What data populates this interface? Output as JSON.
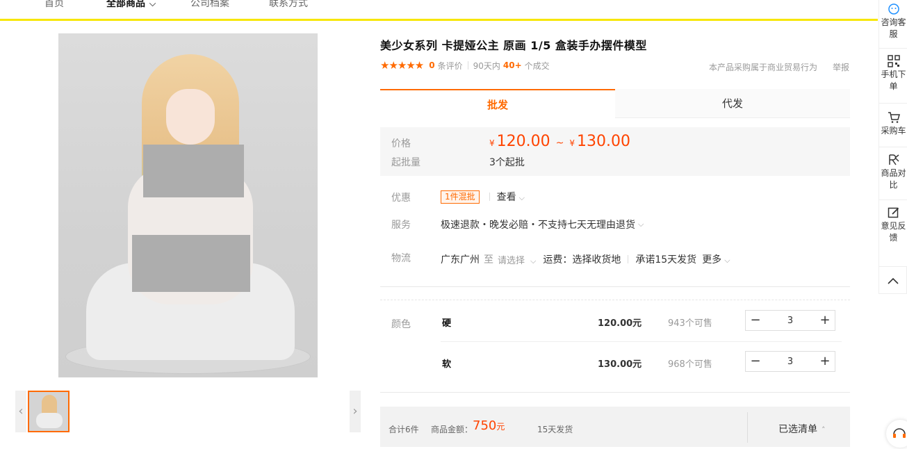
{
  "nav": {
    "items": [
      "首页",
      "全部商品",
      "公司档案",
      "联系方式"
    ]
  },
  "product": {
    "title": "美少女系列 卡提娅公主 原画 1/5 盒装手办摆件模型",
    "rating": {
      "stars": 5,
      "review_count": "0",
      "review_suffix": "条评价",
      "sales_prefix": "90天内",
      "sales_count": "40+",
      "sales_suffix": "个成交"
    },
    "business_note": "本产品采购属于商业贸易行为",
    "report_label": "举报"
  },
  "tabs": [
    {
      "label": "批发",
      "active": true
    },
    {
      "label": "代发",
      "active": false
    }
  ],
  "pricing": {
    "price_label": "价格",
    "currency": "¥",
    "price_min": "120.00",
    "price_max": "130.00",
    "range_sep": "~",
    "moq_label": "起批量",
    "moq_value": "3个起批"
  },
  "promo": {
    "label": "优惠",
    "badge": "1件混批",
    "view_label": "查看"
  },
  "service": {
    "label": "服务",
    "value": "极速退款・晚发必赔・不支持七天无理由退货"
  },
  "logistics": {
    "label": "物流",
    "from": "广东广州",
    "to_word": "至",
    "to_placeholder": "请选择",
    "freight": "运费：选择收货地",
    "promise": "承诺15天发货",
    "more": "更多"
  },
  "sku": {
    "label": "颜色",
    "rows": [
      {
        "name": "硬",
        "price": "120.00元",
        "stock": "943个可售",
        "qty": "3"
      },
      {
        "name": "软",
        "price": "130.00元",
        "stock": "968个可售",
        "qty": "3"
      }
    ]
  },
  "summary": {
    "total_count": "合计6件",
    "amount_label": "商品金额：",
    "amount": "750",
    "amount_unit": "元",
    "ship": "15天发货",
    "list_button": "已选清单"
  },
  "sidebar": {
    "items": [
      {
        "label": "咨询客服",
        "icon": "chat-icon"
      },
      {
        "label": "手机下单",
        "icon": "qr-code-icon"
      },
      {
        "label": "采购车",
        "icon": "cart-icon"
      },
      {
        "label": "商品对比",
        "icon": "compare-icon"
      },
      {
        "label": "意见反馈",
        "icon": "edit-icon"
      }
    ]
  },
  "colors": {
    "accent": "#ff6a00",
    "price": "#ff4400",
    "nav_bar": "#f7e600"
  }
}
